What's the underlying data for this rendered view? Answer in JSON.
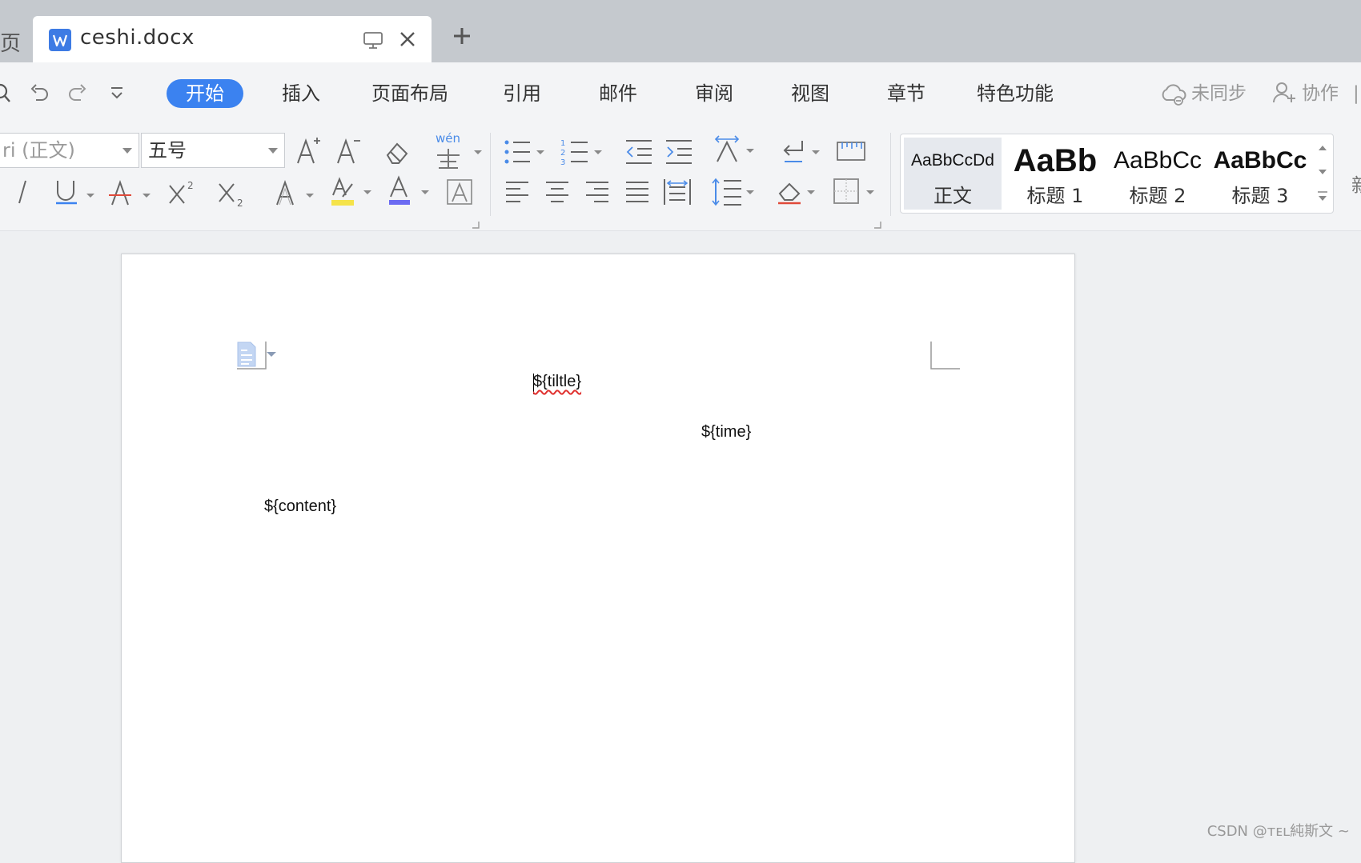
{
  "tabs": {
    "left_partial_glyph": "页",
    "active": {
      "title": "ceshi.docx"
    }
  },
  "menu": {
    "items": [
      "开始",
      "插入",
      "页面布局",
      "引用",
      "邮件",
      "审阅",
      "视图",
      "章节",
      "特色功能"
    ],
    "active_index": 0,
    "sync_label": "未同步",
    "collab_label": "协作"
  },
  "ribbon": {
    "font_name": "ri (正文)",
    "font_size": "五号",
    "pinyin_label": "wén",
    "style_gallery": [
      {
        "sample": "AaBbCcDd",
        "label": "正文"
      },
      {
        "sample": "AaBb",
        "label": "标题 1"
      },
      {
        "sample": "AaBbCc",
        "label": "标题 2"
      },
      {
        "sample": "AaBbCc",
        "label": "标题 3"
      }
    ],
    "right_partial_glyph": "新"
  },
  "document": {
    "title_placeholder": "${tiltle}",
    "time_placeholder": "${time}",
    "content_placeholder": "${content}"
  },
  "watermark": "CSDN @ᴛᴇʟ純斯文 ~",
  "colors": {
    "accent": "#3b82f0",
    "tabbar": "#c5c9ce",
    "spellcheck": "#e0312f"
  }
}
